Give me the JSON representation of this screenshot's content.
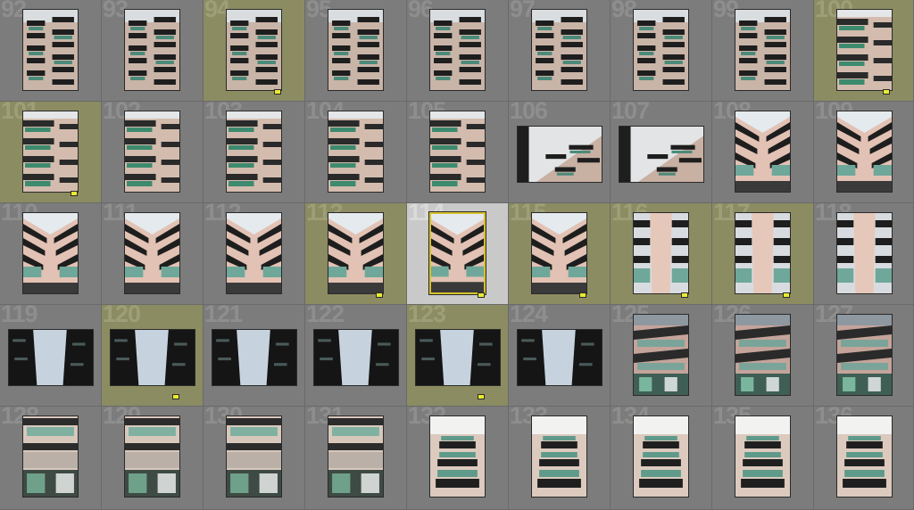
{
  "window": {
    "title": ""
  },
  "grid": {
    "rows": [
      [
        {
          "number": "92",
          "shot": "facade-a",
          "flagged": false,
          "selected": false,
          "orientation": "portrait"
        },
        {
          "number": "93",
          "shot": "facade-a",
          "flagged": false,
          "selected": false,
          "orientation": "portrait"
        },
        {
          "number": "94",
          "shot": "facade-a",
          "flagged": true,
          "selected": false,
          "orientation": "portrait"
        },
        {
          "number": "95",
          "shot": "facade-a",
          "flagged": false,
          "selected": false,
          "orientation": "portrait"
        },
        {
          "number": "96",
          "shot": "facade-a",
          "flagged": false,
          "selected": false,
          "orientation": "portrait"
        },
        {
          "number": "97",
          "shot": "facade-a",
          "flagged": false,
          "selected": false,
          "orientation": "portrait"
        },
        {
          "number": "98",
          "shot": "facade-a",
          "flagged": false,
          "selected": false,
          "orientation": "portrait"
        },
        {
          "number": "99",
          "shot": "facade-a",
          "flagged": false,
          "selected": false,
          "orientation": "portrait"
        },
        {
          "number": "100",
          "shot": "facade-b",
          "flagged": true,
          "selected": false,
          "orientation": "portrait"
        }
      ],
      [
        {
          "number": "101",
          "shot": "facade-b",
          "flagged": true,
          "selected": false,
          "orientation": "portrait"
        },
        {
          "number": "102",
          "shot": "facade-b",
          "flagged": false,
          "selected": false,
          "orientation": "portrait"
        },
        {
          "number": "103",
          "shot": "facade-b",
          "flagged": false,
          "selected": false,
          "orientation": "portrait"
        },
        {
          "number": "104",
          "shot": "facade-b",
          "flagged": false,
          "selected": false,
          "orientation": "portrait"
        },
        {
          "number": "105",
          "shot": "facade-b",
          "flagged": false,
          "selected": false,
          "orientation": "portrait"
        },
        {
          "number": "106",
          "shot": "facade-land",
          "flagged": false,
          "selected": false,
          "orientation": "landscape"
        },
        {
          "number": "107",
          "shot": "facade-land",
          "flagged": false,
          "selected": false,
          "orientation": "landscape"
        },
        {
          "number": "108",
          "shot": "corner",
          "flagged": false,
          "selected": false,
          "orientation": "portrait"
        },
        {
          "number": "109",
          "shot": "corner",
          "flagged": false,
          "selected": false,
          "orientation": "portrait"
        }
      ],
      [
        {
          "number": "110",
          "shot": "corner",
          "flagged": false,
          "selected": false,
          "orientation": "portrait"
        },
        {
          "number": "111",
          "shot": "corner",
          "flagged": false,
          "selected": false,
          "orientation": "portrait"
        },
        {
          "number": "112",
          "shot": "corner",
          "flagged": false,
          "selected": false,
          "orientation": "portrait"
        },
        {
          "number": "113",
          "shot": "corner",
          "flagged": true,
          "selected": false,
          "orientation": "portrait"
        },
        {
          "number": "114",
          "shot": "corner",
          "flagged": true,
          "selected": true,
          "orientation": "portrait"
        },
        {
          "number": "115",
          "shot": "corner",
          "flagged": true,
          "selected": false,
          "orientation": "portrait"
        },
        {
          "number": "116",
          "shot": "corner-close",
          "flagged": true,
          "selected": false,
          "orientation": "portrait"
        },
        {
          "number": "117",
          "shot": "corner-close",
          "flagged": true,
          "selected": false,
          "orientation": "portrait"
        },
        {
          "number": "118",
          "shot": "corner-close",
          "flagged": false,
          "selected": false,
          "orientation": "portrait"
        }
      ],
      [
        {
          "number": "119",
          "shot": "sky",
          "flagged": false,
          "selected": false,
          "orientation": "landscape"
        },
        {
          "number": "120",
          "shot": "sky",
          "flagged": true,
          "selected": false,
          "orientation": "landscape"
        },
        {
          "number": "121",
          "shot": "sky",
          "flagged": false,
          "selected": false,
          "orientation": "landscape"
        },
        {
          "number": "122",
          "shot": "sky",
          "flagged": false,
          "selected": false,
          "orientation": "landscape"
        },
        {
          "number": "123",
          "shot": "sky",
          "flagged": true,
          "selected": false,
          "orientation": "landscape"
        },
        {
          "number": "124",
          "shot": "sky",
          "flagged": false,
          "selected": false,
          "orientation": "landscape"
        },
        {
          "number": "125",
          "shot": "balcony-low",
          "flagged": false,
          "selected": false,
          "orientation": "portrait"
        },
        {
          "number": "126",
          "shot": "balcony-low",
          "flagged": false,
          "selected": false,
          "orientation": "portrait"
        },
        {
          "number": "127",
          "shot": "balcony-low",
          "flagged": false,
          "selected": false,
          "orientation": "portrait"
        }
      ],
      [
        {
          "number": "128",
          "shot": "balcony-up",
          "flagged": false,
          "selected": false,
          "orientation": "portrait"
        },
        {
          "number": "129",
          "shot": "balcony-up",
          "flagged": false,
          "selected": false,
          "orientation": "portrait"
        },
        {
          "number": "130",
          "shot": "balcony-up",
          "flagged": false,
          "selected": false,
          "orientation": "portrait"
        },
        {
          "number": "131",
          "shot": "balcony-up",
          "flagged": false,
          "selected": false,
          "orientation": "portrait"
        },
        {
          "number": "132",
          "shot": "balcony-sky",
          "flagged": false,
          "selected": false,
          "orientation": "portrait"
        },
        {
          "number": "133",
          "shot": "balcony-sky",
          "flagged": false,
          "selected": false,
          "orientation": "portrait"
        },
        {
          "number": "134",
          "shot": "balcony-sky",
          "flagged": false,
          "selected": false,
          "orientation": "portrait"
        },
        {
          "number": "135",
          "shot": "balcony-sky",
          "flagged": false,
          "selected": false,
          "orientation": "portrait"
        },
        {
          "number": "136",
          "shot": "balcony-sky",
          "flagged": false,
          "selected": false,
          "orientation": "portrait"
        }
      ]
    ]
  },
  "colors": {
    "cell_bg": "#7c7c7c",
    "flagged_bg": "#8c8c62",
    "selected_bg": "#c9c9c9",
    "selected_border": "#d6c22a",
    "flag_badge": "#eaea30"
  }
}
